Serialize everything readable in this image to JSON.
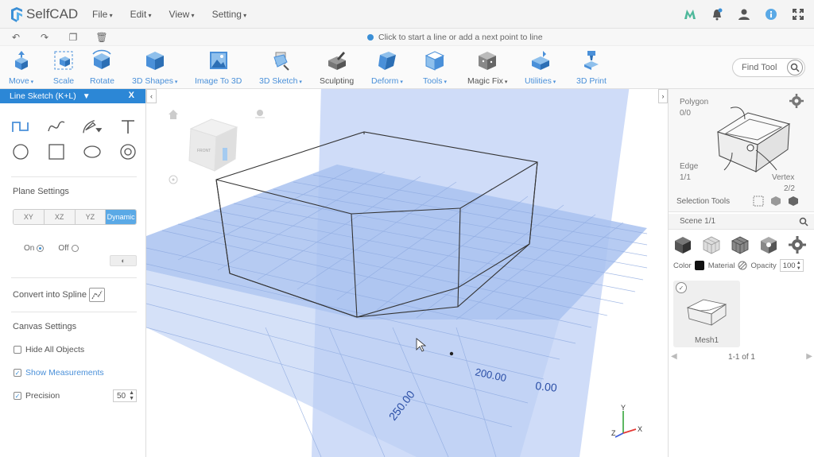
{
  "app": {
    "name": "SelfCAD"
  },
  "menu": [
    "File",
    "Edit",
    "View",
    "Setting"
  ],
  "hint": "Click to start a line or add a next point to line",
  "toolbar": {
    "tools": [
      {
        "label": "Move",
        "dropdown": true,
        "icon": "move-icon"
      },
      {
        "label": "Scale",
        "dropdown": false,
        "icon": "scale-icon"
      },
      {
        "label": "Rotate",
        "dropdown": false,
        "icon": "rotate-icon"
      },
      {
        "label": "3D Shapes",
        "dropdown": true,
        "icon": "cube-icon"
      },
      {
        "label": "Image To 3D",
        "dropdown": false,
        "icon": "image-icon"
      },
      {
        "label": "3D Sketch",
        "dropdown": true,
        "icon": "sketch-icon"
      },
      {
        "label": "Sculpting",
        "dropdown": false,
        "icon": "sculpt-icon"
      },
      {
        "label": "Deform",
        "dropdown": true,
        "icon": "deform-icon"
      },
      {
        "label": "Tools",
        "dropdown": true,
        "icon": "tools-icon"
      },
      {
        "label": "Magic Fix",
        "dropdown": true,
        "icon": "magic-fix-icon"
      },
      {
        "label": "Utilities",
        "dropdown": true,
        "icon": "utilities-icon"
      },
      {
        "label": "3D Print",
        "dropdown": false,
        "icon": "print-icon"
      }
    ],
    "find_tool": "Find Tool"
  },
  "left_panel": {
    "title": "Line Sketch (K+L)",
    "close": "X",
    "plane_settings": "Plane Settings",
    "planes": [
      "XY",
      "XZ",
      "YZ",
      "Dynamic"
    ],
    "active_plane": "Dynamic",
    "on_label": "On",
    "off_label": "Off",
    "convert_spline": "Convert into Spline",
    "canvas_settings": "Canvas Settings",
    "hide_all": "Hide All Objects",
    "show_measurements": "Show Measurements",
    "precision": "Precision",
    "precision_value": "50"
  },
  "viewport": {
    "measure_a": "200.00",
    "measure_b": "0.00",
    "measure_c": "250.00",
    "cube_face": "FRONT",
    "axis_x": "X",
    "axis_y": "Y",
    "axis_z": "Z"
  },
  "right_panel": {
    "polygon": "Polygon",
    "polygon_count": "0/0",
    "edge": "Edge",
    "edge_count": "1/1",
    "vertex": "Vertex",
    "vertex_count": "2/2",
    "selection_tools": "Selection Tools",
    "scene": "Scene 1/1",
    "color": "Color",
    "material": "Material",
    "opacity": "Opacity",
    "opacity_value": "100",
    "mesh_name": "Mesh1",
    "pager": "1-1 of 1"
  },
  "colors": {
    "accent": "#2c87d6",
    "plane": "#6f9ce8"
  }
}
